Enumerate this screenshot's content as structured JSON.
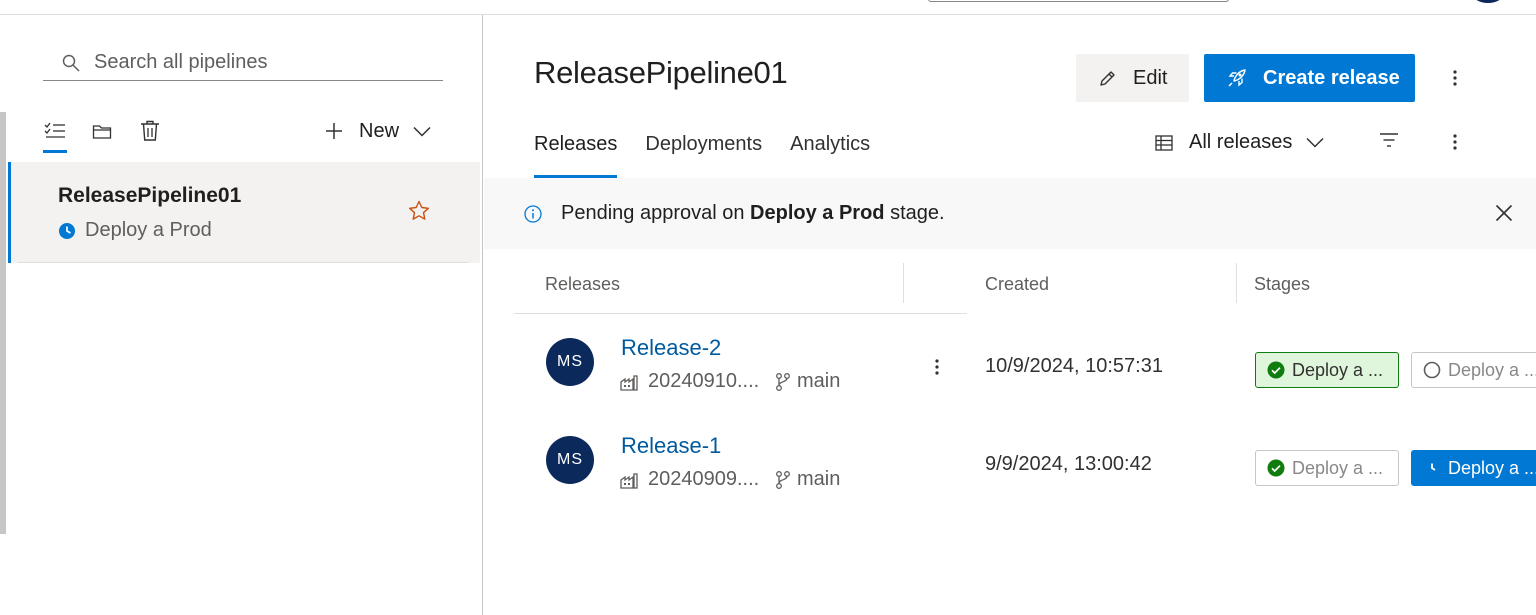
{
  "sidebar": {
    "search_placeholder": "Search all pipelines",
    "new_label": "New",
    "pipelines": [
      {
        "name": "ReleasePipeline01",
        "status": "Deploy a Prod",
        "favorite": false
      }
    ]
  },
  "header": {
    "title": "ReleasePipeline01",
    "edit_label": "Edit",
    "create_release_label": "Create release"
  },
  "tabs": [
    {
      "label": "Releases",
      "active": true
    },
    {
      "label": "Deployments",
      "active": false
    },
    {
      "label": "Analytics",
      "active": false
    }
  ],
  "filter": {
    "selected": "All releases"
  },
  "banner": {
    "prefix": "Pending approval on ",
    "stage_name": "Deploy a Prod",
    "suffix": " stage."
  },
  "grid": {
    "columns": [
      "Releases",
      "Created",
      "Stages"
    ],
    "rows": [
      {
        "initials": "MS",
        "name": "Release-2",
        "build": "20240910....",
        "branch": "main",
        "created": "10/9/2024, 10:57:31",
        "stages": [
          {
            "label": "Deploy a ...",
            "state": "succeeded"
          },
          {
            "label": "Deploy a ...",
            "state": "not-started"
          }
        ]
      },
      {
        "initials": "MS",
        "name": "Release-1",
        "build": "20240909....",
        "branch": "main",
        "created": "9/9/2024, 13:00:42",
        "stages": [
          {
            "label": "Deploy a ...",
            "state": "succeeded"
          },
          {
            "label": "Deploy a ...",
            "state": "pending-approval"
          }
        ]
      }
    ]
  },
  "colors": {
    "accent": "#0078d4",
    "avatar": "#0b2a5b",
    "success": "#107c10",
    "success_bg": "#dff6dd",
    "link": "#005a9e"
  },
  "icons": [
    "search-icon",
    "list-view-icon",
    "folder-icon",
    "trash-icon",
    "plus-icon",
    "chevron-down-icon",
    "clock-icon",
    "star-icon",
    "pencil-icon",
    "rocket-icon",
    "more-vertical-icon",
    "table-icon",
    "filter-icon",
    "info-icon",
    "close-icon",
    "build-icon",
    "branch-icon",
    "check-circle-icon",
    "circle-icon"
  ]
}
